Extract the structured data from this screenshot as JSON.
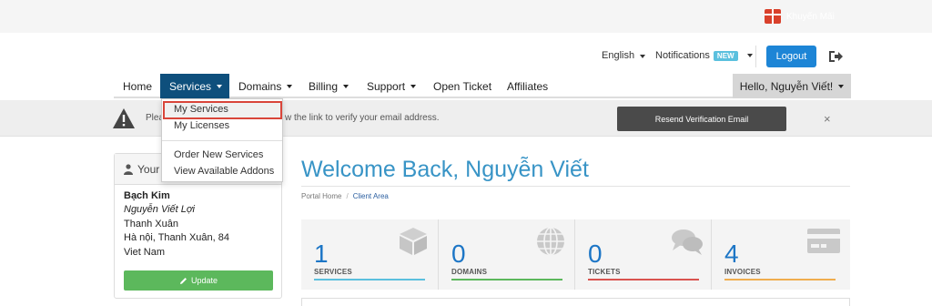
{
  "promo": {
    "text": "Khuyến Mãi"
  },
  "header": {
    "language": "English",
    "notifications": "Notifications",
    "new_badge": "NEW",
    "logout": "Logout"
  },
  "nav": {
    "items": [
      {
        "label": "Home"
      },
      {
        "label": "Services"
      },
      {
        "label": "Domains"
      },
      {
        "label": "Billing"
      },
      {
        "label": "Support"
      },
      {
        "label": "Open Ticket"
      },
      {
        "label": "Affiliates"
      }
    ],
    "hello": "Hello, Nguyễn Viết!"
  },
  "dropdown": {
    "items": [
      {
        "label": "My Services"
      },
      {
        "label": "My Licenses"
      },
      {
        "label": "Order New Services"
      },
      {
        "label": "View Available Addons"
      }
    ]
  },
  "alert": {
    "text_start": "Plea",
    "text_end": "w the link to verify your email address.",
    "resend_button": "Resend Verification Email",
    "close": "×"
  },
  "sidebar": {
    "title": "Your",
    "name": "Bạch Kim",
    "full_name": "Nguyễn Viết Lợi",
    "district": "Thanh Xuân",
    "address": "Hà nội, Thanh Xuân, 84",
    "country": "Viet Nam",
    "update_button": "Update"
  },
  "main": {
    "welcome": "Welcome Back, Nguyễn Viết",
    "breadcrumb": {
      "home": "Portal Home",
      "separator": "/",
      "current": "Client Area"
    }
  },
  "tiles": [
    {
      "count": "1",
      "label": "SERVICES",
      "color": "#5bc0de",
      "icon": "cube-icon"
    },
    {
      "count": "0",
      "label": "DOMAINS",
      "color": "#5cb85c",
      "icon": "globe-icon"
    },
    {
      "count": "0",
      "label": "TICKETS",
      "color": "#d9534f",
      "icon": "comments-icon"
    },
    {
      "count": "4",
      "label": "INVOICES",
      "color": "#f0ad4e",
      "icon": "credit-card-icon"
    }
  ]
}
